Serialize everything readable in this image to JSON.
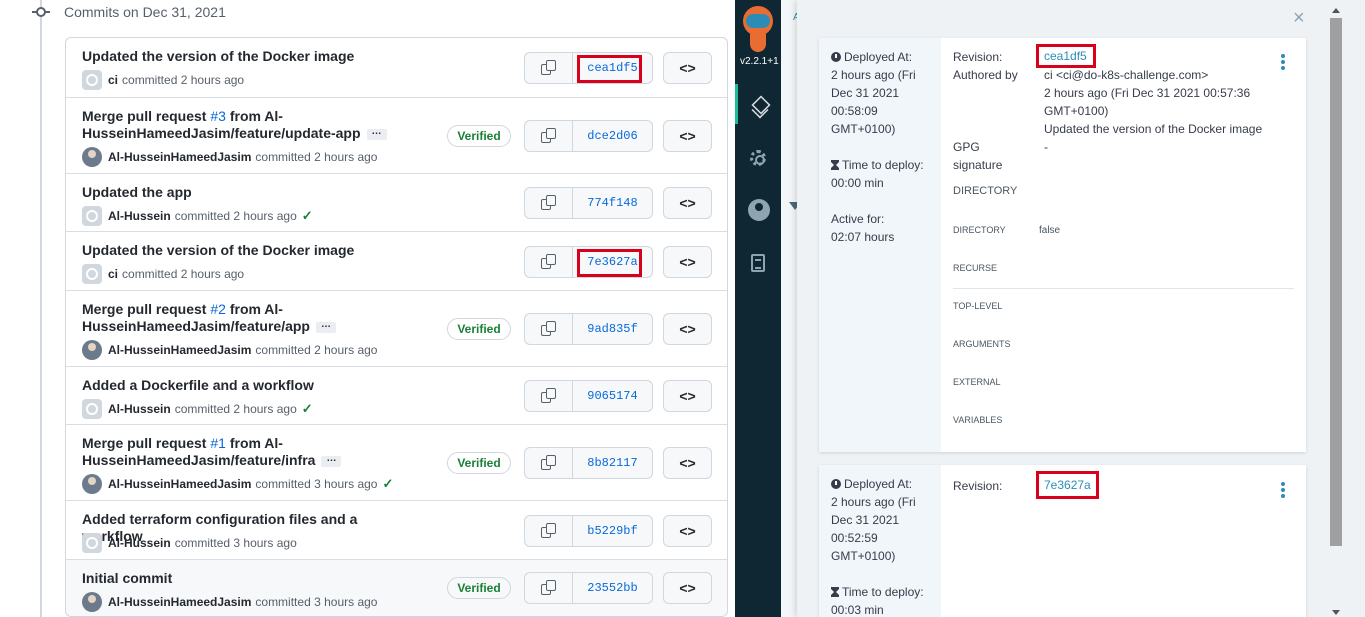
{
  "github": {
    "timeline_title": "Commits on Dec 31, 2021",
    "browse_label": "<>",
    "ellipsis_label": "…",
    "committed_word": "committed",
    "commits": [
      {
        "title_prefix": "Updated the version of the Docker image",
        "pr": "",
        "title_suffix": "",
        "author": "ci",
        "avatar": "bot",
        "time": "2 hours ago",
        "verified": "",
        "check": false,
        "sha": "cea1df5",
        "highlighted": true,
        "ellipsis": false
      },
      {
        "title_prefix": "Merge pull request ",
        "pr": "#3",
        "title_suffix": " from Al-HusseinHameedJasim/feature/update-app",
        "author": "Al-HusseinHameedJasim",
        "avatar": "user",
        "time": "2 hours ago",
        "verified": "Verified",
        "check": false,
        "sha": "dce2d06",
        "highlighted": false,
        "ellipsis": true
      },
      {
        "title_prefix": "Updated the app",
        "pr": "",
        "title_suffix": "",
        "author": "Al-Hussein",
        "avatar": "bot",
        "time": "2 hours ago",
        "verified": "",
        "check": true,
        "sha": "774f148",
        "highlighted": false,
        "ellipsis": false
      },
      {
        "title_prefix": "Updated the version of the Docker image",
        "pr": "",
        "title_suffix": "",
        "author": "ci",
        "avatar": "bot",
        "time": "2 hours ago",
        "verified": "",
        "check": false,
        "sha": "7e3627a",
        "highlighted": true,
        "ellipsis": false
      },
      {
        "title_prefix": "Merge pull request ",
        "pr": "#2",
        "title_suffix": " from Al-HusseinHameedJasim/feature/app",
        "author": "Al-HusseinHameedJasim",
        "avatar": "user",
        "time": "2 hours ago",
        "verified": "Verified",
        "check": false,
        "sha": "9ad835f",
        "highlighted": false,
        "ellipsis": true
      },
      {
        "title_prefix": "Added a Dockerfile and a workflow",
        "pr": "",
        "title_suffix": "",
        "author": "Al-Hussein",
        "avatar": "bot",
        "time": "2 hours ago",
        "verified": "",
        "check": true,
        "sha": "9065174",
        "highlighted": false,
        "ellipsis": false
      },
      {
        "title_prefix": "Merge pull request ",
        "pr": "#1",
        "title_suffix": " from Al-HusseinHameedJasim/feature/infra",
        "author": "Al-HusseinHameedJasim",
        "avatar": "user",
        "time": "3 hours ago",
        "verified": "Verified",
        "check": true,
        "sha": "8b82117",
        "highlighted": false,
        "ellipsis": true
      },
      {
        "title_prefix": "Added terraform configuration files and a workflow",
        "pr": "",
        "title_suffix": "",
        "author": "Al-Hussein",
        "avatar": "bot",
        "time": "3 hours ago",
        "verified": "",
        "check": false,
        "sha": "b5229bf",
        "highlighted": false,
        "ellipsis": false
      },
      {
        "title_prefix": "Initial commit",
        "pr": "",
        "title_suffix": "",
        "author": "Al-HusseinHameedJasim",
        "avatar": "user",
        "time": "3 hours ago",
        "verified": "Verified",
        "check": false,
        "sha": "23552bb",
        "highlighted": false,
        "ellipsis": false
      }
    ]
  },
  "argo": {
    "version": "v2.2.1+1",
    "behind_fragment": "A",
    "close_glyph": "×",
    "cards": [
      {
        "deployed_at_label": "Deployed At:",
        "deployed_at_value": "2 hours ago (Fri Dec 31 2021 00:58:09 GMT+0100)",
        "time_to_deploy_label": "Time to deploy:",
        "time_to_deploy_value": "00:00 min",
        "active_for_label": "Active for:",
        "active_for_value": "02:07 hours",
        "revision_label": "Revision:",
        "revision": "cea1df5",
        "authored_by_label": "Authored by",
        "author_email": "ci <ci@do-k8s-challenge.com>",
        "authored_time": "2 hours ago (Fri Dec 31 2021 00:57:36 GMT+0100)",
        "commit_message": "Updated the version of the Docker image",
        "gpg_label_1": "GPG",
        "gpg_label_2": "signature",
        "gpg_value": "-",
        "directory_header": "DIRECTORY",
        "directory_label": "DIRECTORY",
        "directory_value": "false",
        "recurse_label": "RECURSE",
        "top_level_label": "TOP-LEVEL",
        "arguments_label": "ARGUMENTS",
        "external_label": "EXTERNAL",
        "variables_label": "VARIABLES"
      },
      {
        "deployed_at_label": "Deployed At:",
        "deployed_at_value": "2 hours ago (Fri Dec 31 2021 00:52:59 GMT+0100)",
        "time_to_deploy_label": "Time to deploy:",
        "time_to_deploy_value": "00:03 min",
        "revision_label": "Revision:",
        "revision": "7e3627a"
      }
    ]
  }
}
